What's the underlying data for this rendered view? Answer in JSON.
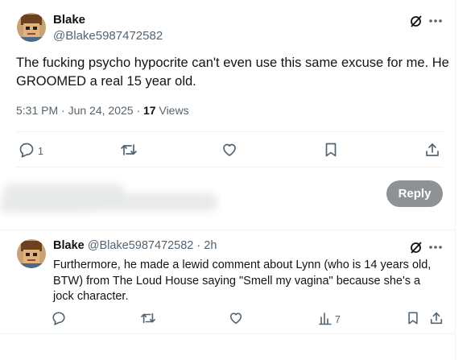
{
  "main_post": {
    "display_name": "Blake",
    "handle": "@Blake5987472582",
    "text": "The fucking psycho hypocrite can't even use this same excuse for me. He GROOMED a real 15 year old.",
    "time": "5:31 PM",
    "date": "Jun 24, 2025",
    "views_count": "17",
    "views_label": "Views",
    "actions": {
      "reply_count": "1",
      "repost_count": "",
      "like_count": ""
    }
  },
  "composer": {
    "reply_button_label": "Reply"
  },
  "reply_post": {
    "display_name": "Blake",
    "handle": "@Blake5987472582",
    "separator": "·",
    "time_ago": "2h",
    "text": "Furthermore, he made a lewid comment about Lynn (who is 14 years old, BTW) from The Loud House saying \"Smell my vagina\" because she's a jock character.",
    "actions": {
      "analytics_count": "7"
    }
  },
  "colors": {
    "secondary_text": "#536471",
    "divider": "#eff3f4",
    "reply_button_disabled": "#8d9296"
  },
  "icons": [
    "avatar",
    "grok-icon",
    "more-icon",
    "reply-icon",
    "repost-icon",
    "like-icon",
    "bookmark-icon",
    "share-icon",
    "analytics-icon"
  ]
}
